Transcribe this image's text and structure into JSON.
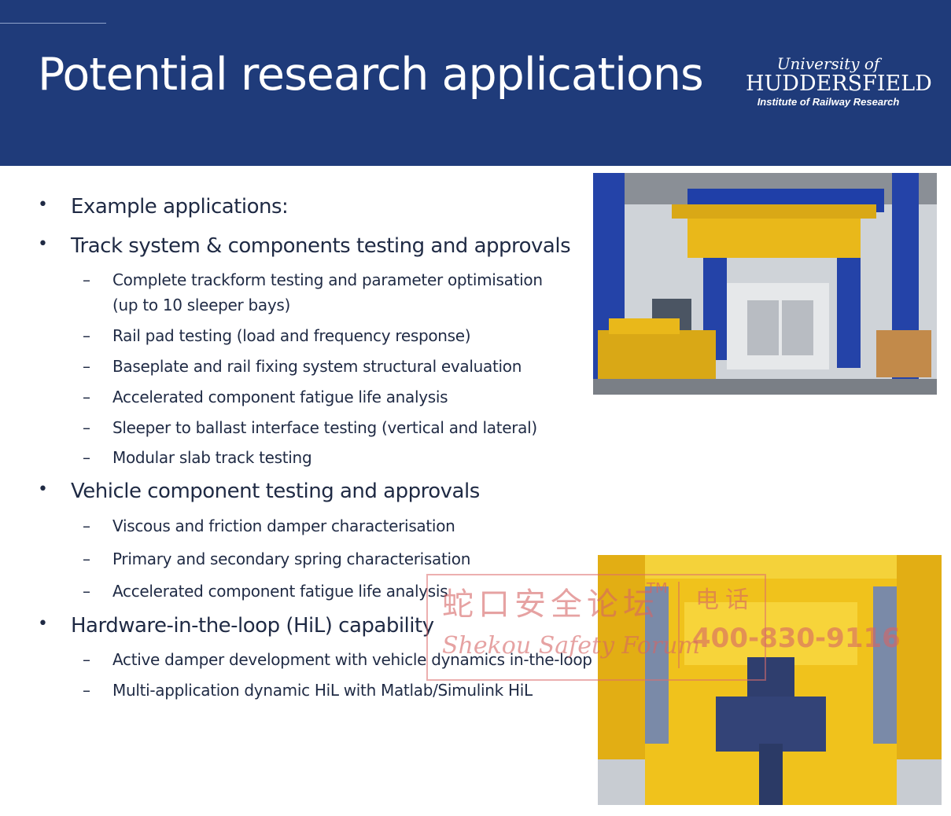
{
  "header": {
    "title": "Potential research applications",
    "logo": {
      "line1": "University of",
      "line2": "HUDDERSFIELD",
      "line3": "Institute of Railway Research"
    }
  },
  "bullets": [
    {
      "level": 1,
      "marker": "•",
      "text": "Example applications:"
    },
    {
      "level": 1,
      "marker": "•",
      "text": "Track system & components testing and approvals"
    },
    {
      "level": 2,
      "marker": "–",
      "text": "Complete trackform testing and parameter optimisation"
    },
    {
      "level": 2,
      "marker": "",
      "text": "(up to 10 sleeper bays)"
    },
    {
      "level": 2,
      "marker": "–",
      "text": "Rail pad testing (load and frequency response)"
    },
    {
      "level": 2,
      "marker": "–",
      "text": "Baseplate and rail fixing system structural evaluation"
    },
    {
      "level": 2,
      "marker": "–",
      "text": "Accelerated component fatigue life analysis"
    },
    {
      "level": 2,
      "marker": "–",
      "text": "Sleeper to ballast interface testing (vertical and lateral)"
    },
    {
      "level": 2,
      "marker": "–",
      "text": "Modular slab track testing"
    },
    {
      "level": 1,
      "marker": "•",
      "text": "Vehicle component testing and approvals"
    },
    {
      "level": 2,
      "marker": "–",
      "text": "Viscous and friction damper characterisation"
    },
    {
      "level": 2,
      "marker": "–",
      "text": "Primary and secondary spring characterisation"
    },
    {
      "level": 2,
      "marker": "–",
      "text": "Accelerated component fatigue life analysis"
    },
    {
      "level": 1,
      "marker": "•",
      "text": "Hardware-in-the-loop (HiL) capability"
    },
    {
      "level": 2,
      "marker": "–",
      "text": "Active damper development with vehicle dynamics in-the-loop"
    },
    {
      "level": 2,
      "marker": "–",
      "text": "Multi-application dynamic HiL with Matlab/Simulink HiL"
    }
  ],
  "watermark": {
    "chinese": "蛇口安全论坛",
    "tm": "TM",
    "english": "Shekou Safety Forum",
    "tel_label": "电话",
    "tel_number": "400-830-9116"
  },
  "colors": {
    "header_bg": "#1f3b7a",
    "text": "#1f2a44",
    "rig_yellow": "#e9b81a",
    "rig_blue": "#1f3fa8"
  }
}
